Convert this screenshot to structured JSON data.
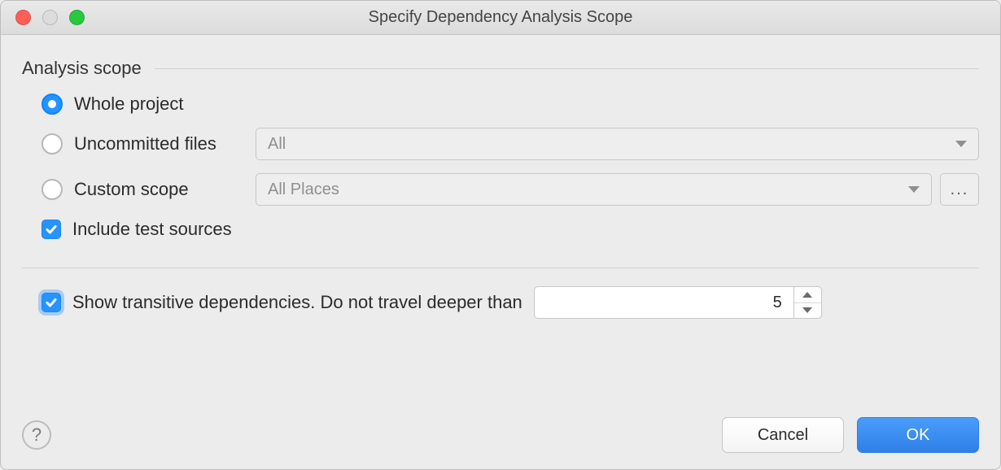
{
  "window": {
    "title": "Specify Dependency Analysis Scope"
  },
  "group": {
    "label": "Analysis scope"
  },
  "options": {
    "whole_project": {
      "label": "Whole project",
      "selected": true
    },
    "uncommitted": {
      "label": "Uncommitted files",
      "selected": false,
      "combo_value": "All"
    },
    "custom": {
      "label": "Custom scope",
      "selected": false,
      "combo_value": "All Places"
    },
    "include_tests": {
      "label": "Include test sources",
      "checked": true
    }
  },
  "transitive": {
    "label": "Show transitive dependencies. Do not travel deeper than",
    "checked": true,
    "value": "5"
  },
  "buttons": {
    "help_glyph": "?",
    "cancel": "Cancel",
    "ok": "OK",
    "ellipsis": "..."
  }
}
